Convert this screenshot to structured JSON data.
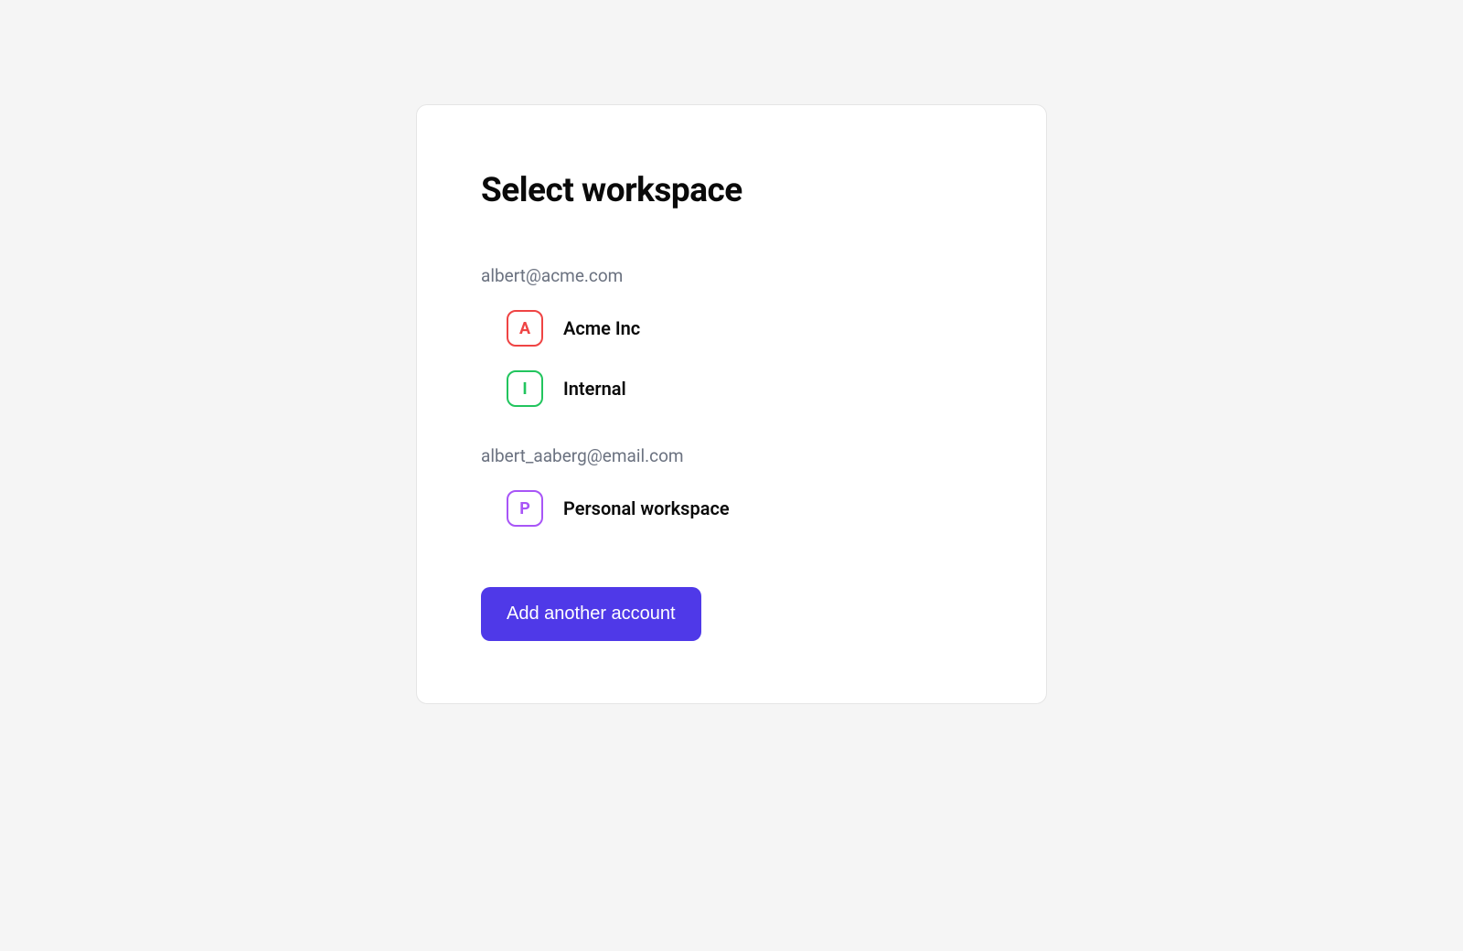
{
  "title": "Select workspace",
  "accounts": [
    {
      "email": "albert@acme.com",
      "workspaces": [
        {
          "initial": "A",
          "name": "Acme Inc",
          "avatarClass": "avatar-red"
        },
        {
          "initial": "I",
          "name": "Internal",
          "avatarClass": "avatar-green"
        }
      ]
    },
    {
      "email": "albert_aaberg@email.com",
      "workspaces": [
        {
          "initial": "P",
          "name": "Personal workspace",
          "avatarClass": "avatar-purple"
        }
      ]
    }
  ],
  "addAccountLabel": "Add another account"
}
